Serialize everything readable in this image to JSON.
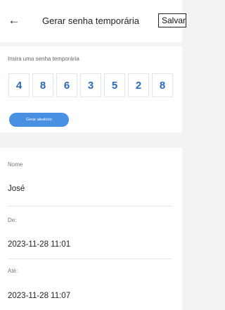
{
  "header": {
    "title": "Gerar senha temporária",
    "save_label": "Salvar"
  },
  "password": {
    "label": "Insira uma senha temporária",
    "digits": [
      "4",
      "8",
      "6",
      "3",
      "5",
      "2",
      "8"
    ],
    "random_label": "Gerar aleatório"
  },
  "details": {
    "name_label": "Nome",
    "name_value": "José",
    "from_label": "De:",
    "from_value": "2023-11-28 11:01",
    "to_label": "Até:",
    "to_value": "2023-11-28 11:07"
  },
  "colors": {
    "accent": "#4a90e2",
    "digit": "#2a6bb8",
    "background": "#f3f3f5"
  }
}
